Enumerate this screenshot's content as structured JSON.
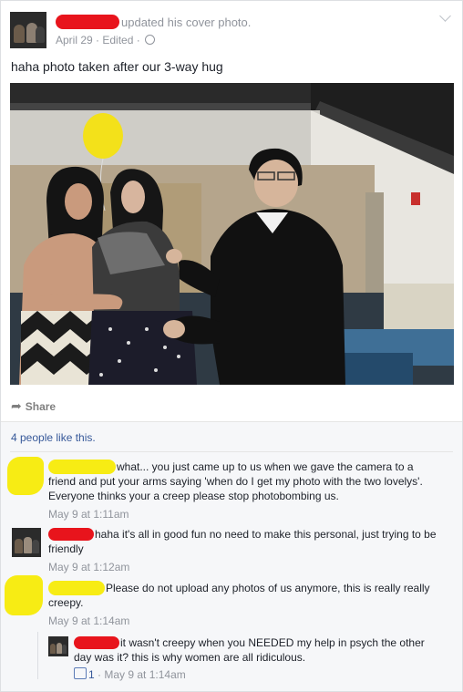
{
  "post": {
    "action_text": "updated his cover photo.",
    "date": "April 29",
    "separator": "·",
    "edited": "Edited",
    "caption": "haha photo taken after our 3-way hug"
  },
  "actions": {
    "share_label": "Share"
  },
  "likes": {
    "text": "4 people like this."
  },
  "comments": [
    {
      "text": "what... you just came up to us when we gave the camera to a friend and put your arms saying 'when do I get my photo with the two lovelys'. Everyone thinks your a creep please stop photobombing us.",
      "time": "May 9 at 1:11am"
    },
    {
      "text": "haha it's all in good fun no need to make this personal, just trying to be friendly",
      "time": "May 9 at 1:12am"
    },
    {
      "text": "Please do not upload any photos of us anymore, this is really really creepy.",
      "time": "May 9 at 1:14am"
    },
    {
      "text": "it wasn't creepy when you NEEDED my help in psych the other day was it? this is why women are all ridiculous.",
      "like_count": "1",
      "time": "May 9 at 1:14am"
    }
  ],
  "colors": {
    "redaction_red": "#e8141c",
    "redaction_yellow": "#f7ec14",
    "link_blue": "#365899"
  },
  "icons": [
    "chevron-down-icon",
    "globe-icon",
    "share-icon",
    "like-thumb-icon"
  ]
}
